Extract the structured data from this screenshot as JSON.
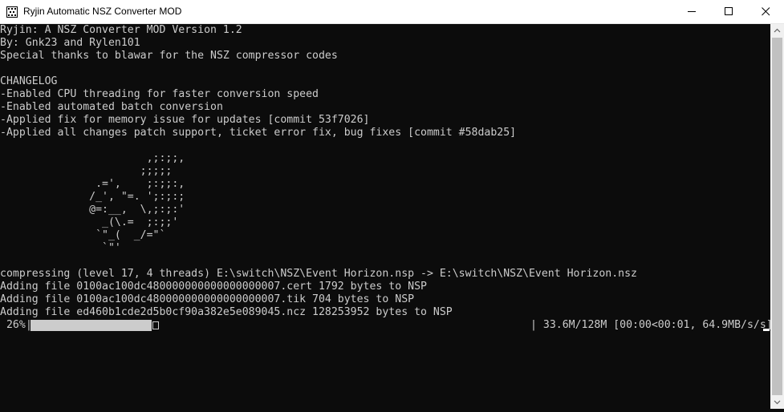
{
  "window": {
    "title": "Ryjin Automatic NSZ Converter MOD",
    "icon": "console-app-icon",
    "controls": [
      "minimize-icon",
      "maximize-icon",
      "close-icon"
    ]
  },
  "console": {
    "lines": [
      "Ryjin: A NSZ Converter MOD Version 1.2",
      "By: Gnk23 and Rylen101",
      "Special thanks to blawar for the NSZ compressor codes",
      "",
      "CHANGELOG",
      "-Enabled CPU threading for faster conversion speed",
      "-Enabled automated batch conversion",
      "-Applied fix for memory issue for updates [commit 53f7026]",
      "-Applied all changes patch support, ticket error fix, bug fixes [commit #58dab25]"
    ],
    "ascii_art": "                       ,;:;;,\n                      ;;;;;\n               .=',    ;:;;:,\n              /_', \"=. ';:;:;\n              @=:__,  \\,;:;:'\n                _(\\.=  ;:;;'\n               `\"_(  _/=\"`\n                `\"'",
    "output_lines": [
      "compressing (level 17, 4 threads) E:\\switch\\NSZ\\Event Horizon.nsp -> E:\\switch\\NSZ\\Event Horizon.nsz",
      "Adding file 0100ac100dc480000000000000000007.cert 1792 bytes to NSP",
      "Adding file 0100ac100dc480000000000000000007.tik 704 bytes to NSP",
      "Adding file ed460b1cde2d5b0cf90a382e5e089045.ncz 128253952 bytes to NSP"
    ],
    "progress": {
      "percent_label": " 26%",
      "fraction": 0.26,
      "stats": "| 33.6M/128M [00:00<00:01, 64.9MB/s/s]"
    }
  },
  "colors": {
    "console_bg": "#0c0c0c",
    "console_text": "#cccccc",
    "titlebar_bg": "#ffffff"
  }
}
